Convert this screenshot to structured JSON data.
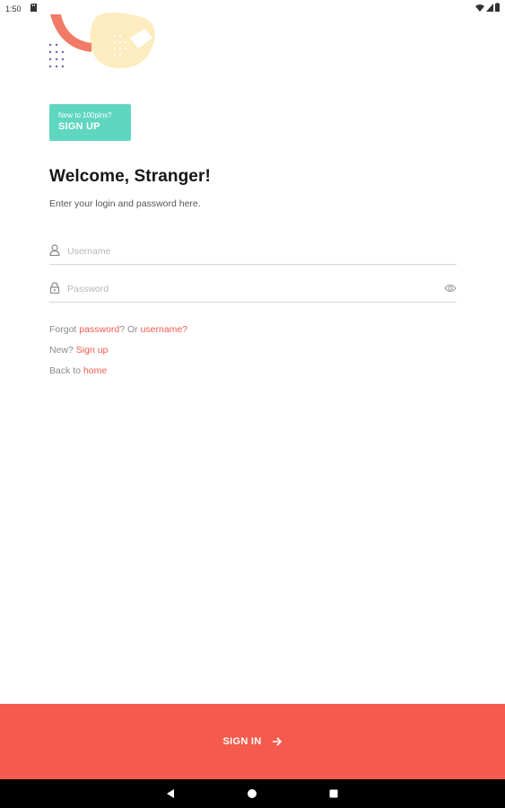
{
  "status_bar": {
    "time": "1:50",
    "icons": [
      "sd-card-icon",
      "wifi-icon",
      "signal-icon",
      "battery-icon"
    ]
  },
  "signup_badge": {
    "prompt": "New to 100pins?",
    "action": "SIGN UP"
  },
  "welcome": {
    "title": "Welcome, Stranger!",
    "subtitle": "Enter your login and password here."
  },
  "form": {
    "username": {
      "placeholder": "Username",
      "value": ""
    },
    "password": {
      "placeholder": "Password",
      "value": ""
    }
  },
  "links": {
    "forgot_prefix": "Forgot ",
    "password_link": "password",
    "forgot_middle": "? Or ",
    "username_link": "username?",
    "new_prefix": "New? ",
    "signup_link": "Sign up",
    "back_prefix": "Back to ",
    "home_link": "home"
  },
  "signin": {
    "label": "SIGN IN"
  },
  "colors": {
    "accent": "#f45b4e",
    "badge": "#5fd6c0",
    "deco_yellow": "#fdecc0",
    "deco_dots": "#6b5fb0"
  }
}
